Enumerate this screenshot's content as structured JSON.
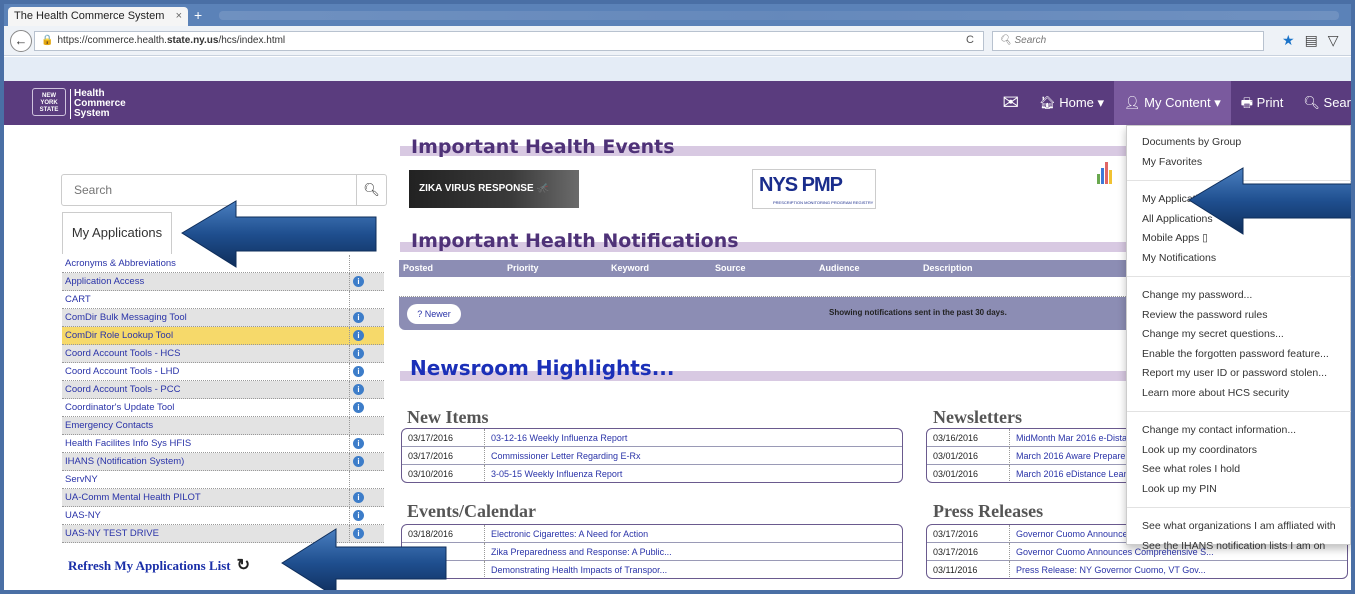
{
  "browser": {
    "tab_title": "The Health Commerce System",
    "tab_close": "×",
    "new_tab": "+",
    "back": "←",
    "url_prefix": "https://commerce.health.",
    "url_domain": "state.ny.us",
    "url_path": "/hcs/index.html",
    "reload": "C",
    "search_placeholder": "Search",
    "search_icon": "search-icon",
    "toolbar_icons": [
      "star-icon",
      "reading-list-icon",
      "pocket-icon"
    ]
  },
  "site": {
    "logo_state": "NEW YORK STATE",
    "logo_line1": "Health",
    "logo_line2": "Commerce",
    "logo_line3": "System",
    "nav": {
      "mail_icon": "envelope-icon",
      "home": "Home",
      "my_content": "My Content",
      "print": "Print",
      "search": "Sear"
    }
  },
  "left": {
    "search_placeholder": "Search",
    "tab_label": "My Applications",
    "apps": [
      {
        "label": "Acronyms & Abbreviations",
        "info": false,
        "style": ""
      },
      {
        "label": "Application Access",
        "info": true,
        "style": "alt"
      },
      {
        "label": "CART",
        "info": false,
        "style": ""
      },
      {
        "label": "ComDir Bulk Messaging Tool",
        "info": true,
        "style": "alt"
      },
      {
        "label": "ComDir Role Lookup Tool",
        "info": true,
        "style": "hl"
      },
      {
        "label": "Coord Account Tools - HCS",
        "info": true,
        "style": "alt"
      },
      {
        "label": "Coord Account Tools - LHD",
        "info": true,
        "style": ""
      },
      {
        "label": "Coord Account Tools - PCC",
        "info": true,
        "style": "alt"
      },
      {
        "label": "Coordinator's Update Tool",
        "info": true,
        "style": ""
      },
      {
        "label": "Emergency Contacts",
        "info": false,
        "style": "alt"
      },
      {
        "label": "Health Facilites Info Sys HFIS",
        "info": true,
        "style": ""
      },
      {
        "label": "IHANS (Notification System)",
        "info": true,
        "style": "alt"
      },
      {
        "label": "ServNY",
        "info": false,
        "style": ""
      },
      {
        "label": "UA-Comm Mental Health PILOT",
        "info": true,
        "style": "alt"
      },
      {
        "label": "UAS-NY",
        "info": true,
        "style": ""
      },
      {
        "label": "UAS-NY TEST DRIVE",
        "info": true,
        "style": "alt"
      }
    ],
    "refresh_label": "Refresh My Applications List"
  },
  "main": {
    "events_title": "Important Health Events",
    "banner_zika": "ZIKA VIRUS RESPONSE",
    "banner_pmp": "NYS PMP",
    "banner_pmp_sub": "PRESCRIPTION MONITORING PROGRAM REGISTRY",
    "notifications_title": "Important Health Notifications",
    "notif_columns": [
      "Posted",
      "Priority",
      "Keyword",
      "Source",
      "Audience",
      "Description"
    ],
    "newer_button": "? Newer",
    "showing_text": "Showing notifications sent in the past 30 days.",
    "newsroom_title": "Newsroom Highlights...",
    "new_items_title": "New Items",
    "new_items": [
      {
        "date": "03/17/2016",
        "title": "03-12-16 Weekly Influenza Report"
      },
      {
        "date": "03/17/2016",
        "title": "Commissioner Letter Regarding E-Rx"
      },
      {
        "date": "03/10/2016",
        "title": "3-05-15 Weekly Influenza Report"
      }
    ],
    "newsletters_title": "Newsletters",
    "newsletters": [
      {
        "date": "03/16/2016",
        "title": "MidMonth Mar 2016 e-Distar"
      },
      {
        "date": "03/01/2016",
        "title": "March 2016 Aware Prepare I"
      },
      {
        "date": "03/01/2016",
        "title": "March 2016 eDistance Learn"
      }
    ],
    "events_cal_title": "Events/Calendar",
    "events": [
      {
        "date": "03/18/2016",
        "title": "Electronic Cigarettes: A Need for Action"
      },
      {
        "date": "16",
        "title": "Zika Preparedness and Response: A Public..."
      },
      {
        "date": "16",
        "title": "Demonstrating Health Impacts of Transpor..."
      }
    ],
    "press_title": "Press Releases",
    "press": [
      {
        "date": "03/17/2016",
        "title": "Governor Cuomo Announce"
      },
      {
        "date": "03/17/2016",
        "title": "Governor Cuomo Announces Comprehensive S..."
      },
      {
        "date": "03/11/2016",
        "title": "Press Release: NY Governor Cuomo, VT Gov..."
      }
    ]
  },
  "dropdown": {
    "group1": [
      "Documents by Group",
      "My Favorites"
    ],
    "group2": [
      "My Applications",
      "All Applications",
      "Mobile Apps ▯",
      "My Notifications"
    ],
    "group3": [
      "Change my password...",
      "Review the password rules",
      "Change my secret questions...",
      "Enable the forgotten password feature...",
      "Report my user ID or password stolen...",
      "Learn more about HCS security"
    ],
    "group4": [
      "Change my contact information...",
      "Look up my coordinators",
      "See what roles I hold",
      "Look up my PIN"
    ],
    "group5": [
      "See what organizations I am affliated with",
      "See the IHANS notification lists I am on"
    ]
  },
  "colors": {
    "nav_bg": "#5a3c7e",
    "title_purple": "#4f3278",
    "news_blue": "#1b30b8",
    "link_blue": "#2a33a8",
    "highlight": "#f6d96a",
    "arrow": "#1f4f8f"
  }
}
